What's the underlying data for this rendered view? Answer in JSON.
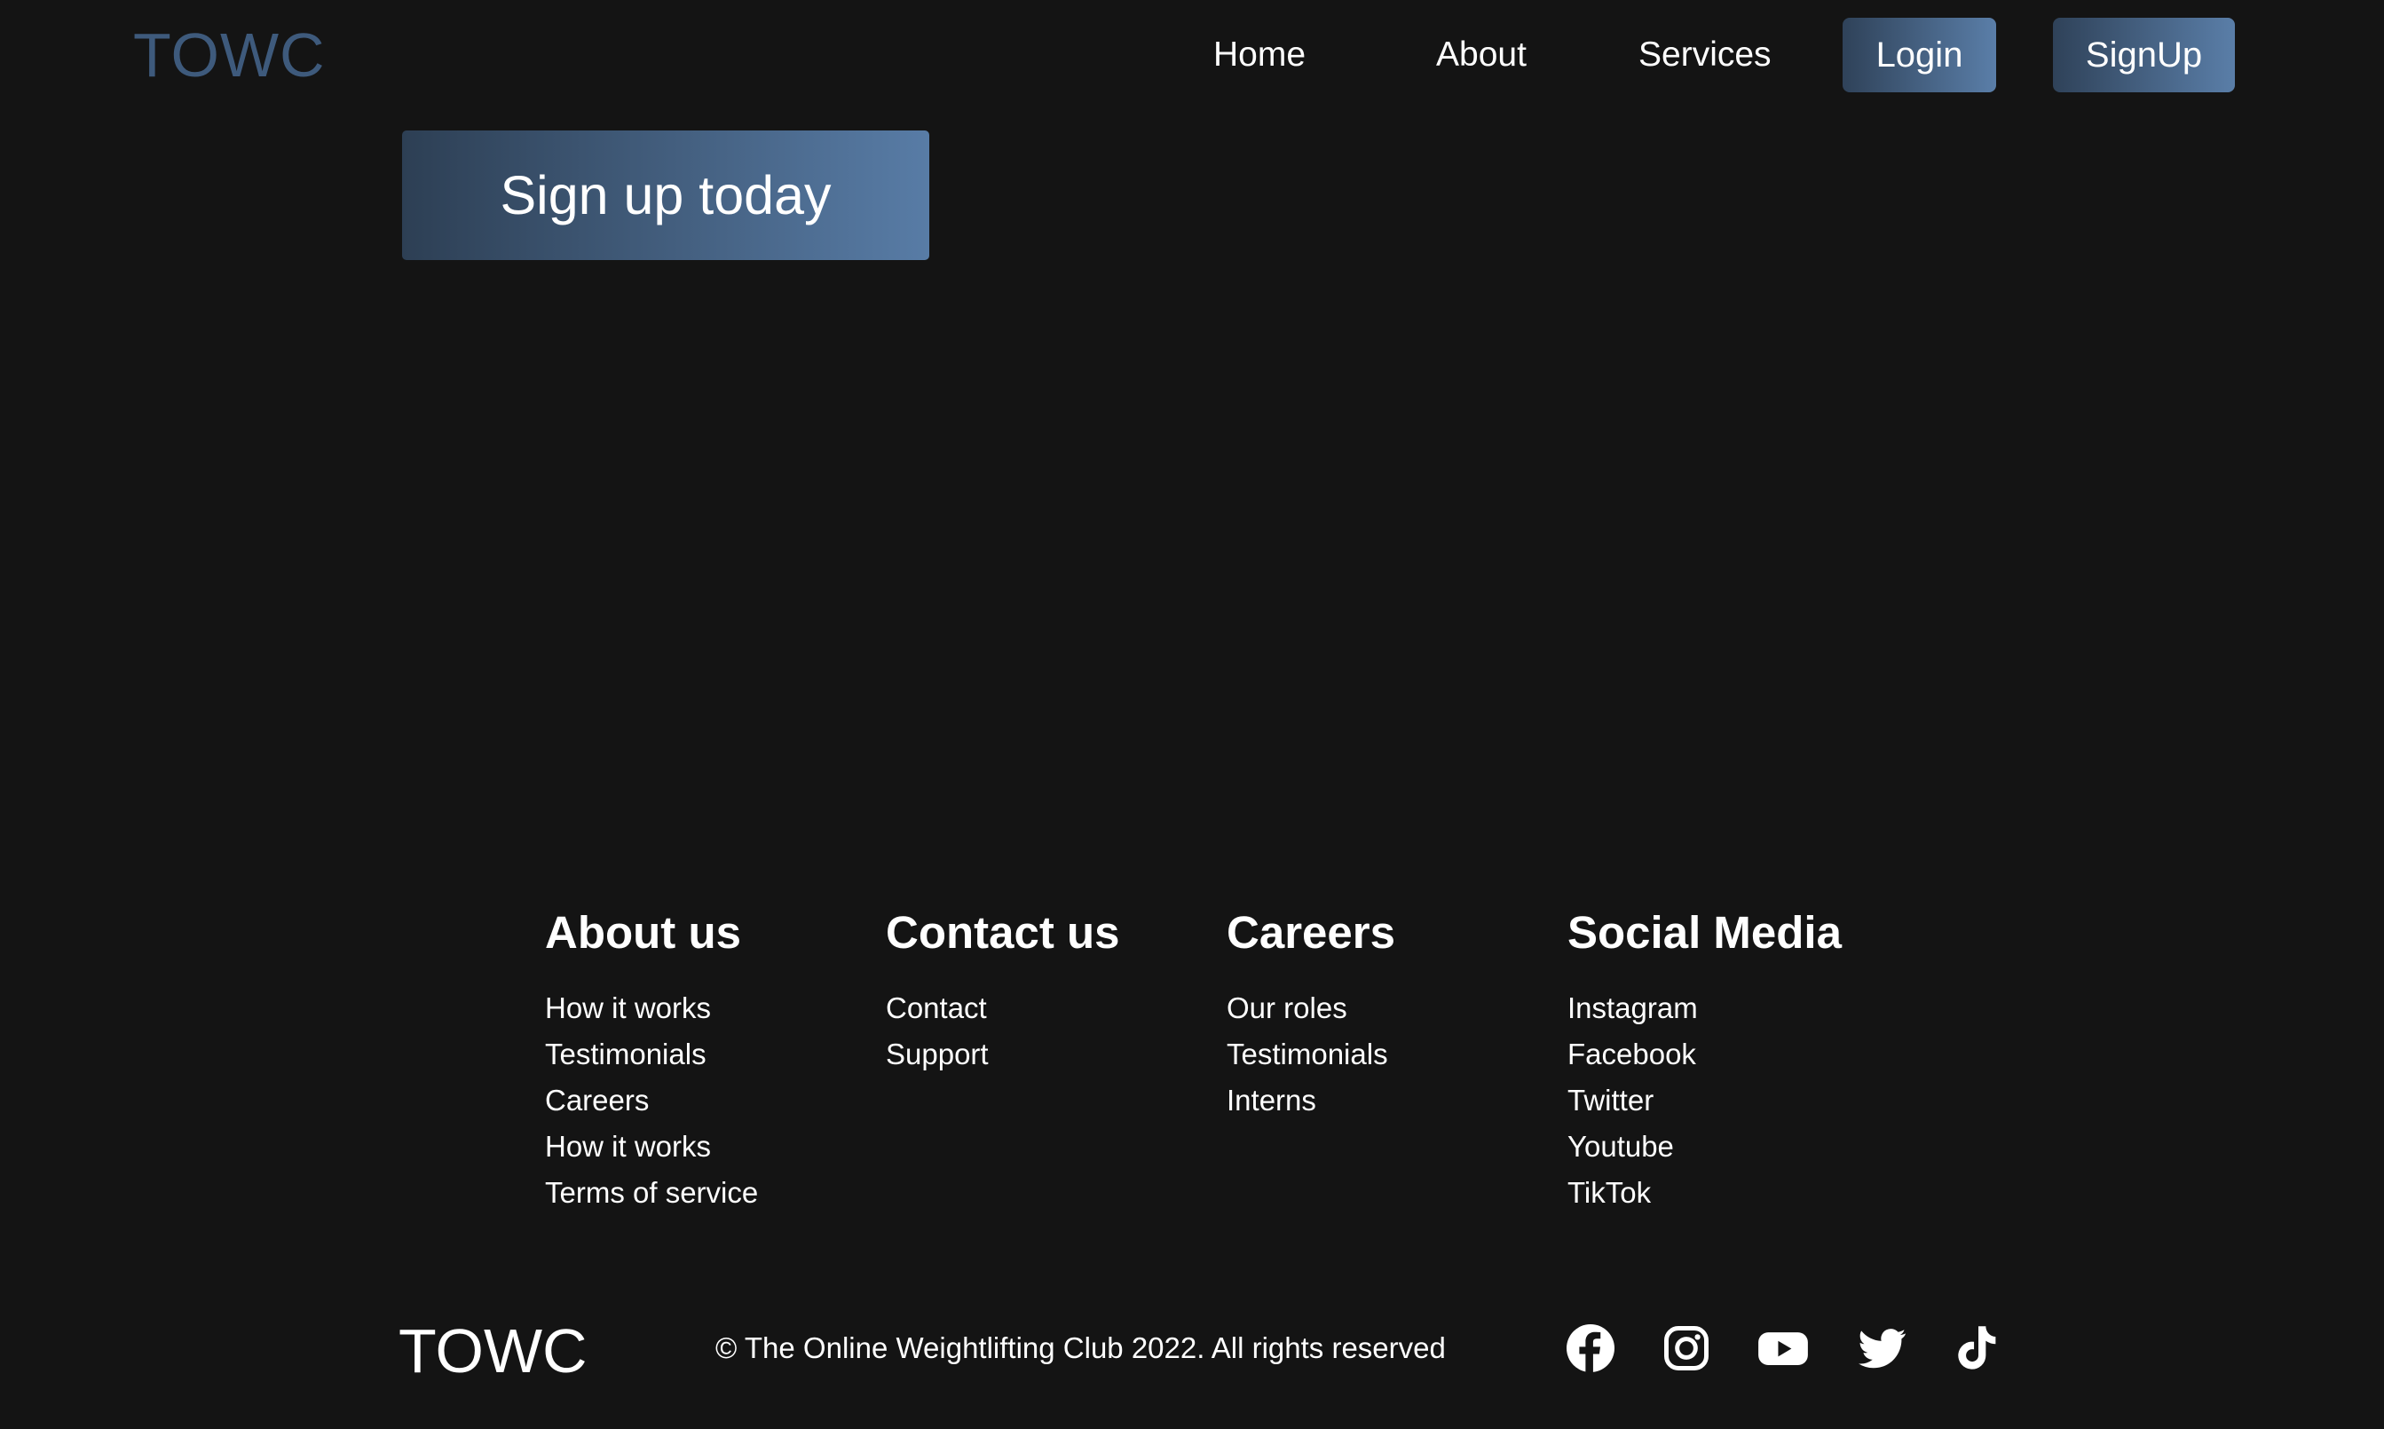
{
  "header": {
    "logo": "TOWC",
    "nav": {
      "home": "Home",
      "about": "About",
      "services": "Services"
    },
    "login_label": "Login",
    "signup_label": "SignUp"
  },
  "hero": {
    "cta_label": "Sign up today"
  },
  "footer": {
    "columns": [
      {
        "title": "About us",
        "links": [
          "How it works",
          "Testimonials",
          "Careers",
          "How it works",
          "Terms of service"
        ]
      },
      {
        "title": "Contact us",
        "links": [
          "Contact",
          "Support"
        ]
      },
      {
        "title": "Careers",
        "links": [
          "Our roles",
          "Testimonials",
          "Interns"
        ]
      },
      {
        "title": "Social Media",
        "links": [
          "Instagram",
          "Facebook",
          "Twitter",
          "Youtube",
          "TikTok"
        ]
      }
    ],
    "logo": "TOWC",
    "copyright": "© The Online Weightlifting Club 2022. All rights reserved",
    "social_icons": [
      "facebook-icon",
      "instagram-icon",
      "youtube-icon",
      "twitter-icon",
      "tiktok-icon"
    ]
  },
  "colors": {
    "background": "#141414",
    "logo_accent": "#3e5a7c",
    "button_gradient_start": "#2f4259",
    "button_gradient_end": "#5a7ea8",
    "text": "#ffffff"
  }
}
